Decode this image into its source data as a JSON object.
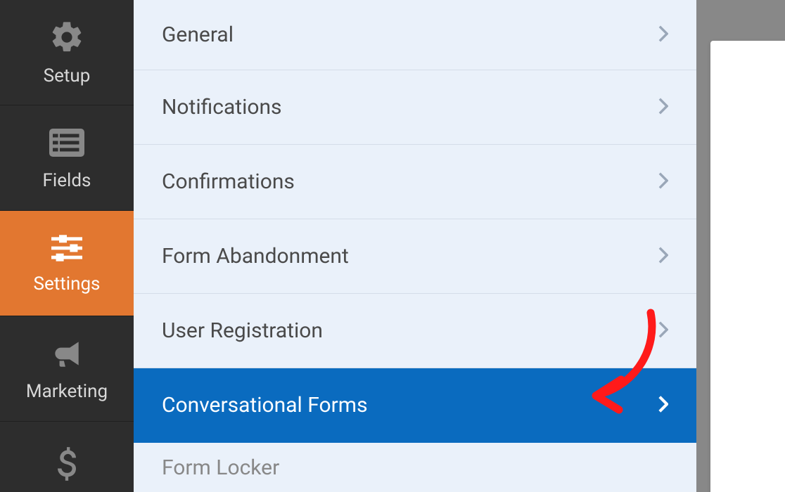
{
  "sidebar": {
    "items": [
      {
        "label": "Setup",
        "icon": "gear"
      },
      {
        "label": "Fields",
        "icon": "list"
      },
      {
        "label": "Settings",
        "icon": "sliders",
        "active": true
      },
      {
        "label": "Marketing",
        "icon": "bullhorn"
      },
      {
        "label": "",
        "icon": "dollar"
      }
    ]
  },
  "panel": {
    "rows": [
      {
        "label": "General"
      },
      {
        "label": "Notifications"
      },
      {
        "label": "Confirmations"
      },
      {
        "label": "Form Abandonment"
      },
      {
        "label": "User Registration"
      },
      {
        "label": "Conversational Forms",
        "selected": true
      },
      {
        "label": "Form Locker"
      }
    ]
  },
  "annotation": {
    "arrow_color": "#ff1a1a"
  }
}
